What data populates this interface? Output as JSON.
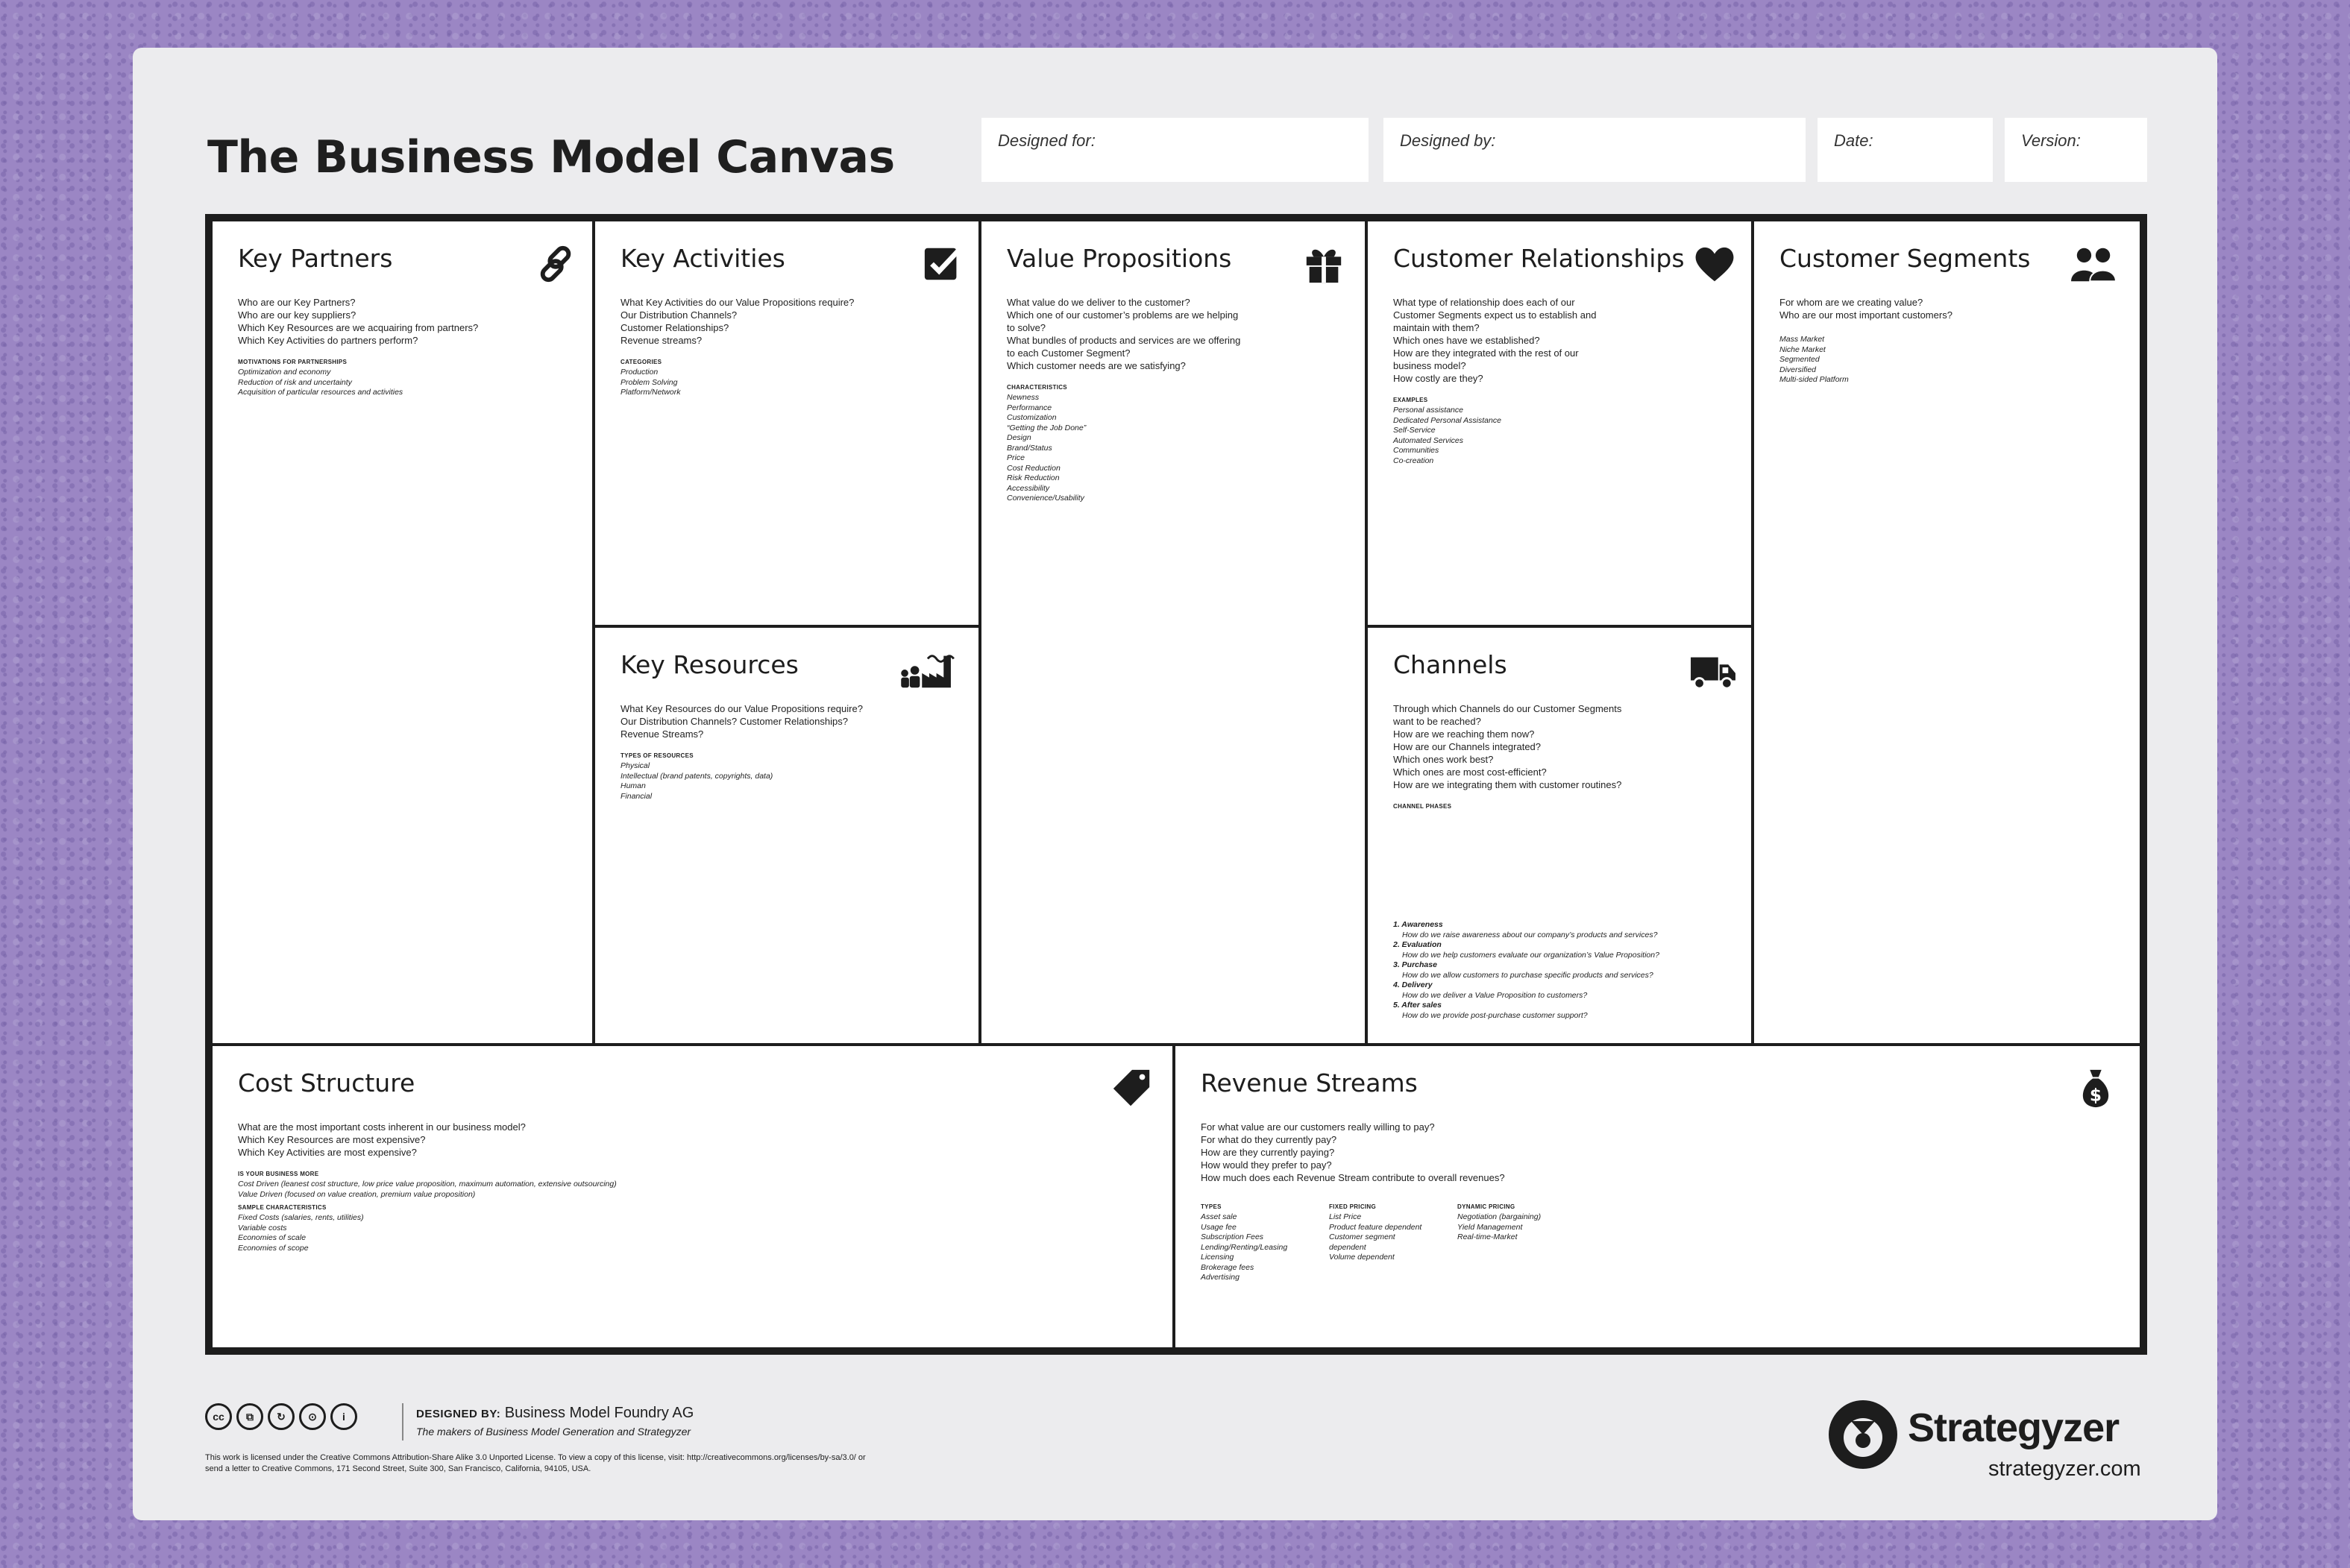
{
  "title": "The Business Model Canvas",
  "meta": {
    "designed_for": "Designed for:",
    "designed_by": "Designed by:",
    "date": "Date:",
    "version": "Version:"
  },
  "blocks": {
    "key_partners": {
      "title": "Key Partners",
      "icon": "link-icon",
      "questions": [
        "Who are our Key Partners?",
        "Who are our key suppliers?",
        "Which Key Resources are we acquairing from partners?",
        "Which Key Activities do partners perform?"
      ],
      "section": "MOTIVATIONS FOR PARTNERSHIPS",
      "items": [
        "Optimization and economy",
        "Reduction of risk and uncertainty",
        "Acquisition of particular resources and activities"
      ]
    },
    "key_activities": {
      "title": "Key Activities",
      "icon": "checkbox-icon",
      "questions": [
        "What Key Activities do our Value Propositions require?",
        "Our Distribution Channels?",
        "Customer Relationships?",
        "Revenue streams?"
      ],
      "section": "CATEGORIES",
      "items": [
        "Production",
        "Problem Solving",
        "Platform/Network"
      ]
    },
    "key_resources": {
      "title": "Key Resources",
      "icon": "factory-icon",
      "questions": [
        "What Key Resources do our Value Propositions require?",
        "Our Distribution Channels? Customer Relationships?",
        "Revenue Streams?"
      ],
      "section": "TYPES OF RESOURCES",
      "items": [
        "Physical",
        "Intellectual (brand patents, copyrights, data)",
        "Human",
        "Financial"
      ]
    },
    "value_propositions": {
      "title": "Value Propositions",
      "icon": "gift-icon",
      "questions": [
        "What value do we deliver to the customer?",
        "Which one of our customer’s problems are we helping to solve?",
        "What bundles of products and services are we offering to each Customer Segment?",
        "Which customer needs are we satisfying?"
      ],
      "section": "CHARACTERISTICS",
      "items": [
        "Newness",
        "Performance",
        "Customization",
        "“Getting the Job Done”",
        "Design",
        "Brand/Status",
        "Price",
        "Cost Reduction",
        "Risk Reduction",
        "Accessibility",
        "Convenience/Usability"
      ]
    },
    "customer_relationships": {
      "title": "Customer Relationships",
      "icon": "heart-icon",
      "questions": [
        "What type of relationship does each of our Customer Segments expect us to establish and maintain with them?",
        "Which ones have we established?",
        "How are they integrated with the rest of our business model?",
        "How costly are they?"
      ],
      "section": "EXAMPLES",
      "items": [
        "Personal assistance",
        "Dedicated Personal Assistance",
        "Self-Service",
        "Automated Services",
        "Communities",
        "Co-creation"
      ]
    },
    "channels": {
      "title": "Channels",
      "icon": "truck-icon",
      "questions": [
        "Through which Channels do our Customer Segments want to be reached?",
        "How are we reaching them now?",
        "How are our Channels integrated?",
        "Which ones work best?",
        "Which ones are most cost-efficient?",
        "How are we integrating them with customer routines?"
      ],
      "section": "CHANNEL PHASES",
      "phases": [
        {
          "name": "1. Awareness",
          "text": "How do we raise awareness about our company’s products and services?"
        },
        {
          "name": "2. Evaluation",
          "text": "How do we help customers evaluate our organization’s Value Proposition?"
        },
        {
          "name": "3. Purchase",
          "text": "How do we allow customers to purchase specific products and services?"
        },
        {
          "name": "4. Delivery",
          "text": "How do we deliver a Value Proposition to customers?"
        },
        {
          "name": "5. After sales",
          "text": "How do we provide post-purchase customer support?"
        }
      ]
    },
    "customer_segments": {
      "title": "Customer Segments",
      "icon": "people-icon",
      "questions": [
        "For whom are we creating value?",
        "Who are our most important customers?"
      ],
      "items": [
        "Mass Market",
        "Niche Market",
        "Segmented",
        "Diversified",
        "Multi-sided Platform"
      ]
    },
    "cost_structure": {
      "title": "Cost Structure",
      "icon": "price-tag-icon",
      "questions": [
        "What are the most important costs inherent in our business model?",
        "Which Key Resources are most expensive?",
        "Which Key Activities are most expensive?"
      ],
      "section1": "IS YOUR BUSINESS MORE",
      "items1": [
        "Cost Driven (leanest cost structure, low price value proposition, maximum automation, extensive outsourcing)",
        "Value Driven (focused on value creation, premium value proposition)"
      ],
      "section2": "SAMPLE CHARACTERISTICS",
      "items2": [
        "Fixed Costs (salaries, rents, utilities)",
        "Variable costs",
        "Economies of scale",
        "Economies of scope"
      ]
    },
    "revenue_streams": {
      "title": "Revenue Streams",
      "icon": "money-bag-icon",
      "questions": [
        "For what value are our customers really willing to pay?",
        "For what do they currently pay?",
        "How are they currently paying?",
        "How would they prefer to pay?",
        "How much does each Revenue Stream contribute to overall revenues?"
      ],
      "types_title": "TYPES",
      "types": [
        "Asset sale",
        "Usage fee",
        "Subscription Fees",
        "Lending/Renting/Leasing",
        "Licensing",
        "Brokerage fees",
        "Advertising"
      ],
      "fixed_title": "FIXED PRICING",
      "fixed": [
        "List Price",
        "Product feature dependent",
        "Customer segment",
        "dependent",
        "Volume dependent"
      ],
      "dynamic_title": "DYNAMIC PRICING",
      "dynamic": [
        "Negotiation (bargaining)",
        "Yield Management",
        "Real-time-Market"
      ]
    }
  },
  "footer": {
    "designed_by_label": "DESIGNED BY:",
    "designed_by_value": "Business Model Foundry AG",
    "designed_by_sub": "The makers of Business Model Generation and Strategyzer",
    "license": "This work is licensed under the Creative Commons Attribution-Share Alike 3.0 Unported License. To view a copy of this license, visit: http://creativecommons.org/licenses/by-sa/3.0/ or send a letter to Creative Commons, 171 Second Street, Suite 300, San Francisco, California, 94105, USA.",
    "cc_icons": [
      "cc",
      "copy",
      "remix",
      "share",
      "attribution"
    ],
    "cc_labels": [
      "cc",
      "⧉",
      "↻",
      "⊙",
      "i"
    ]
  },
  "brand": {
    "name": "Strategyzer",
    "url": "strategyzer.com",
    "logo": "strategyzer-logo"
  },
  "colors": {
    "background": "#9b86c4",
    "sheet": "#ececee",
    "border": "#1d1d1d"
  }
}
